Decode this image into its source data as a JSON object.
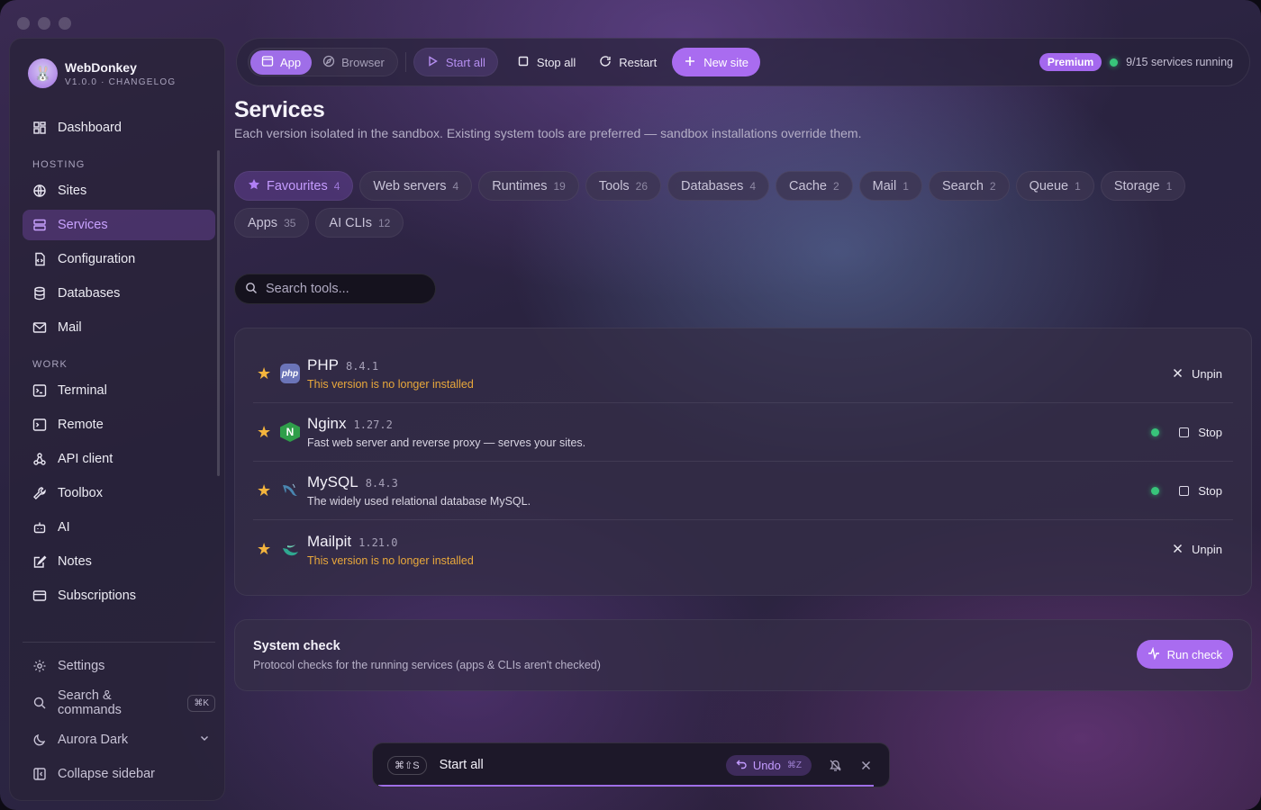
{
  "app": {
    "name": "WebDonkey",
    "version": "V1.0.0 · CHANGELOG"
  },
  "sidebar": {
    "top": [
      {
        "label": "Dashboard",
        "icon": "dashboard-icon"
      }
    ],
    "hosting_header": "HOSTING",
    "hosting": [
      {
        "label": "Sites",
        "icon": "globe-icon"
      },
      {
        "label": "Services",
        "icon": "server-icon",
        "active": true
      },
      {
        "label": "Configuration",
        "icon": "config-file-icon"
      },
      {
        "label": "Databases",
        "icon": "database-icon"
      },
      {
        "label": "Mail",
        "icon": "mail-icon"
      }
    ],
    "work_header": "WORK",
    "work": [
      {
        "label": "Terminal",
        "icon": "terminal-icon"
      },
      {
        "label": "Remote",
        "icon": "remote-icon"
      },
      {
        "label": "API client",
        "icon": "api-icon"
      },
      {
        "label": "Toolbox",
        "icon": "wrench-icon"
      },
      {
        "label": "AI",
        "icon": "bot-icon"
      },
      {
        "label": "Notes",
        "icon": "notes-icon"
      },
      {
        "label": "Subscriptions",
        "icon": "card-icon"
      }
    ],
    "settings": "Settings",
    "search": "Search & commands",
    "search_kbd": "⌘K",
    "theme": "Aurora Dark",
    "collapse": "Collapse sidebar"
  },
  "toolbar": {
    "app": "App",
    "browser": "Browser",
    "start_all": "Start all",
    "stop_all": "Stop all",
    "restart": "Restart",
    "new_site": "New site",
    "premium": "Premium",
    "status": "9/15 services running"
  },
  "page": {
    "title": "Services",
    "subtitle": "Each version isolated in the sandbox. Existing system tools are preferred — sandbox installations override them."
  },
  "filters": [
    {
      "label": "Favourites",
      "count": "4",
      "active": true
    },
    {
      "label": "Web servers",
      "count": "4"
    },
    {
      "label": "Runtimes",
      "count": "19"
    },
    {
      "label": "Tools",
      "count": "26"
    },
    {
      "label": "Databases",
      "count": "4"
    },
    {
      "label": "Cache",
      "count": "2"
    },
    {
      "label": "Mail",
      "count": "1"
    },
    {
      "label": "Search",
      "count": "2"
    },
    {
      "label": "Queue",
      "count": "1"
    },
    {
      "label": "Storage",
      "count": "1"
    },
    {
      "label": "Apps",
      "count": "35"
    },
    {
      "label": "AI CLIs",
      "count": "12"
    }
  ],
  "search": {
    "placeholder": "Search tools..."
  },
  "services": [
    {
      "name": "PHP",
      "version": "8.4.1",
      "desc": "This version is no longer installed",
      "warn": true,
      "action": "Unpin",
      "running": false,
      "icon": "php-icon",
      "icon_text": "php",
      "icon_color": "#6b74b8"
    },
    {
      "name": "Nginx",
      "version": "1.27.2",
      "desc": "Fast web server and reverse proxy — serves your sites.",
      "warn": false,
      "action": "Stop",
      "running": true,
      "icon": "nginx-icon",
      "icon_text": "N",
      "icon_color": "#2f9e4a"
    },
    {
      "name": "MySQL",
      "version": "8.4.3",
      "desc": "The widely used relational database MySQL.",
      "warn": false,
      "action": "Stop",
      "running": true,
      "icon": "mysql-dolphin-icon",
      "icon_text": "",
      "icon_color": "#3e6d8c"
    },
    {
      "name": "Mailpit",
      "version": "1.21.0",
      "desc": "This version is no longer installed",
      "warn": true,
      "action": "Unpin",
      "running": false,
      "icon": "mailpit-icon",
      "icon_text": "",
      "icon_color": "#2b8c82"
    }
  ],
  "system_check": {
    "title": "System check",
    "subtitle": "Protocol checks for the running services (apps & CLIs aren't checked)",
    "button": "Run check"
  },
  "toast": {
    "shortcut": "⌘⇧S",
    "message": "Start all",
    "undo": "Undo",
    "undo_kbd": "⌘Z",
    "progress": 0.97
  },
  "colors": {
    "accent": "#a96cf0",
    "running": "#38c47a",
    "warning": "#e9a83b",
    "star": "#f5b53d"
  }
}
